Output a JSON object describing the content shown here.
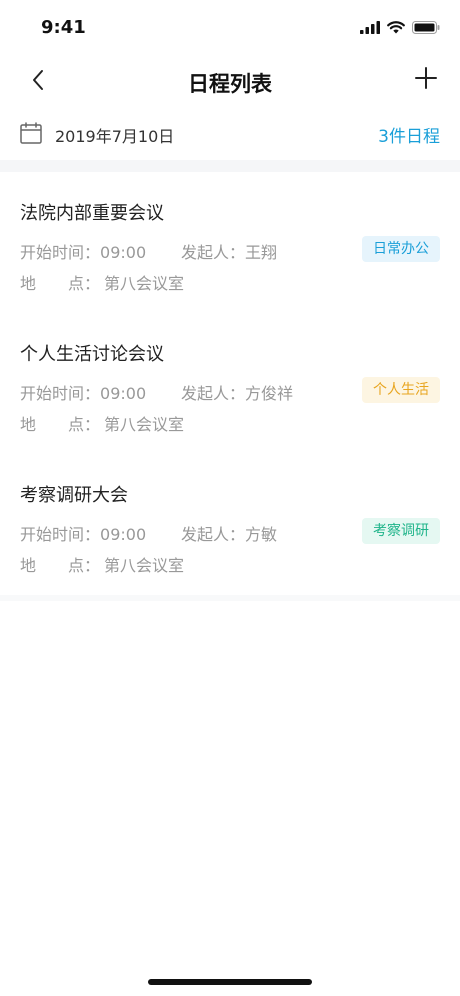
{
  "status_bar": {
    "time": "9:41"
  },
  "nav": {
    "title": "日程列表"
  },
  "date_bar": {
    "date": "2019年7月10日",
    "count": "3件日程"
  },
  "labels": {
    "start_time": "开始时间：",
    "sponsor": "发起人：",
    "location": "地　　点："
  },
  "schedules": [
    {
      "title": "法院内部重要会议",
      "time": "09:00",
      "sponsor": "王翔",
      "location": "第八会议室",
      "tag": "日常办公"
    },
    {
      "title": "个人生活讨论会议",
      "time": "09:00",
      "sponsor": "方俊祥",
      "location": "第八会议室",
      "tag": "个人生活"
    },
    {
      "title": "考察调研大会",
      "time": "09:00",
      "sponsor": "方敏",
      "location": "第八会议室",
      "tag": "考察调研"
    }
  ],
  "colors": {
    "accent": "#1a9fd8",
    "tag_blue": "#1a9fd8",
    "tag_yellow": "#e8a51f",
    "tag_green": "#1fb48a"
  }
}
